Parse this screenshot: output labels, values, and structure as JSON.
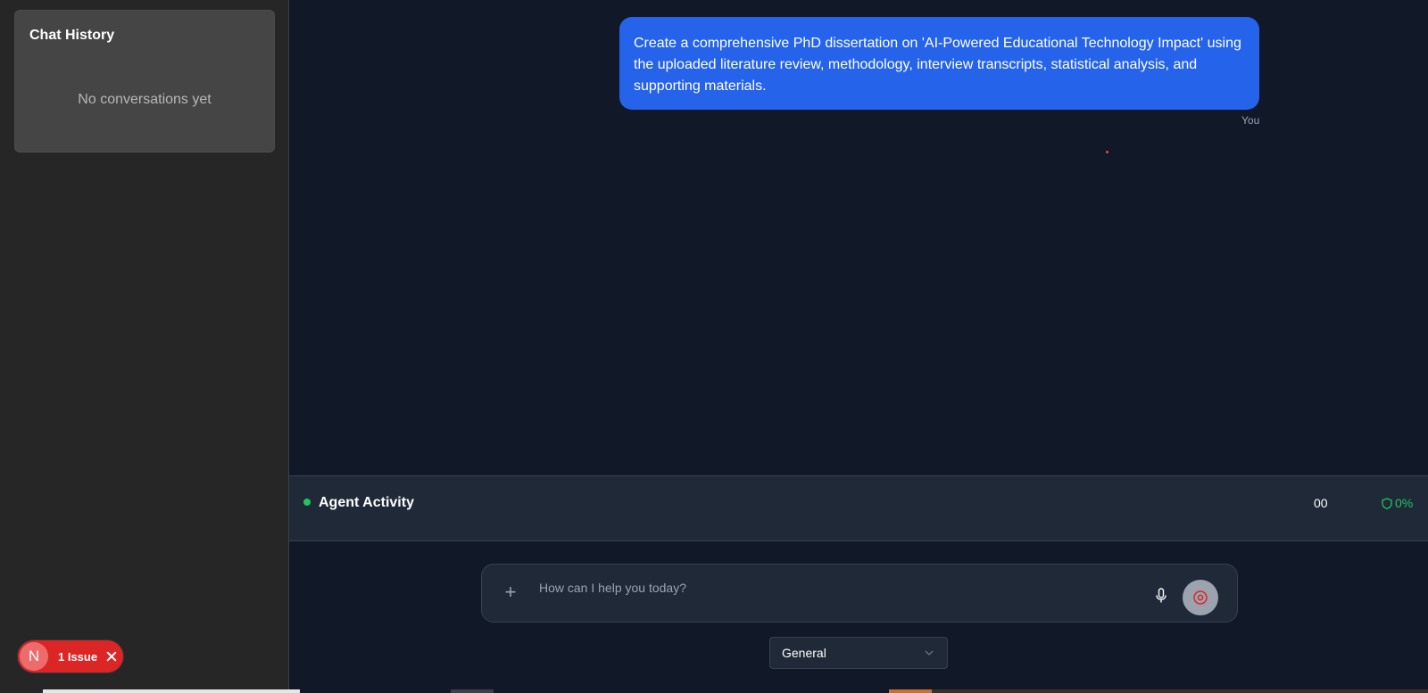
{
  "sidebar": {
    "history_title": "Chat History",
    "history_empty": "No conversations yet"
  },
  "issue_badge": {
    "avatar_letter": "N",
    "label": "1 Issue"
  },
  "chat": {
    "messages": [
      {
        "text": "Create a comprehensive PhD dissertation on 'AI-Powered Educational Technology Impact' using the uploaded literature review, methodology, interview transcripts, statistical analysis, and supporting materials.",
        "sender": "You"
      }
    ]
  },
  "agent_activity": {
    "title": "Agent Activity",
    "counter": "00",
    "percent": "0%",
    "status_color": "#22c55e"
  },
  "composer": {
    "placeholder": "How can I help you today?",
    "value": ""
  },
  "mode_select": {
    "selected": "General"
  },
  "colors": {
    "accent": "#2563eb",
    "success": "#22c55e",
    "danger": "#dc2626"
  }
}
